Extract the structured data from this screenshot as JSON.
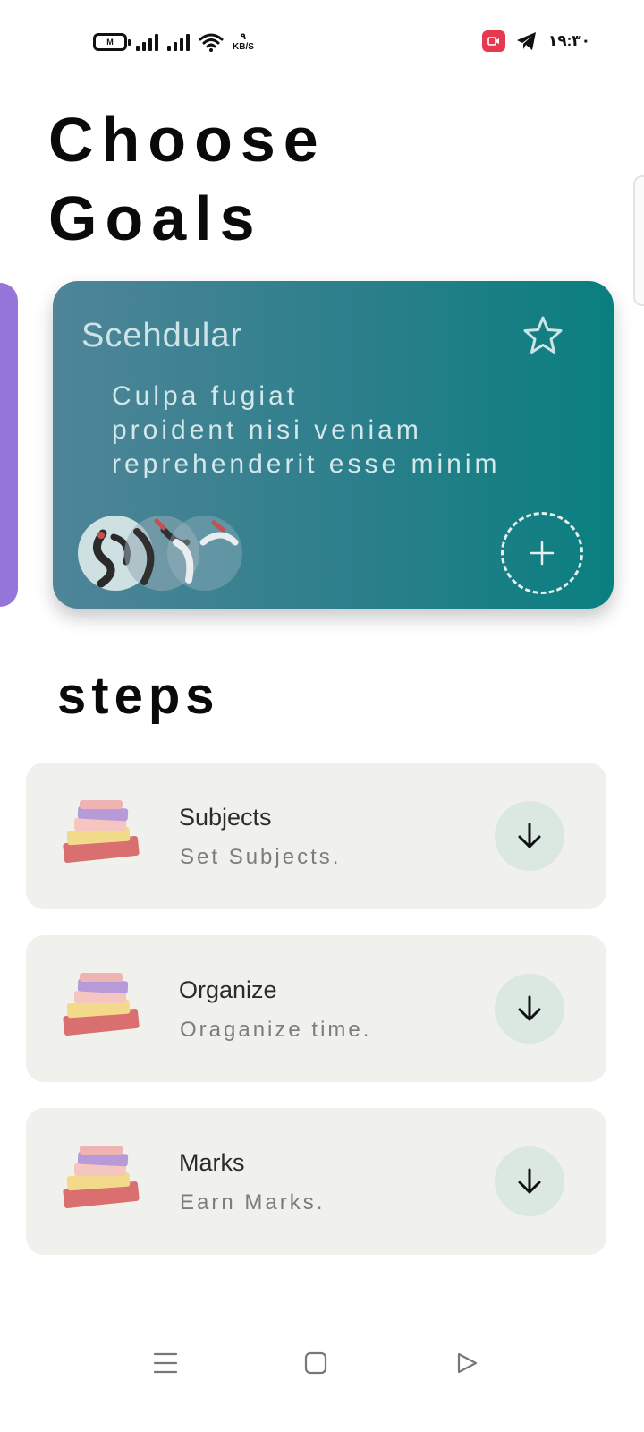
{
  "status_bar": {
    "time": "۱۹:۳۰",
    "network_speed_value": "۹",
    "network_speed_unit": "KB/S",
    "battery_label": "M",
    "icons": [
      "battery-icon",
      "signal-icon",
      "signal-icon",
      "wifi-icon",
      "screen-record-icon",
      "telegram-icon"
    ]
  },
  "page": {
    "title_line1": "Choose",
    "title_line2": "Goals"
  },
  "goal_card": {
    "title": "Scehdular",
    "body_line1": "Culpa fugiat",
    "body_line2": "proident nisi veniam",
    "body_line3": "reprehenderit esse minim",
    "favorite_icon": "star-outline-icon",
    "add_icon": "plus-icon",
    "colors": {
      "gradient_start": "#4f8598",
      "gradient_end": "#0a7f7f",
      "side_card": "#9575d9"
    }
  },
  "steps": {
    "title": "steps",
    "items": [
      {
        "name": "Subjects",
        "description": "Set Subjects.",
        "icon": "books-icon",
        "action_icon": "arrow-down-icon"
      },
      {
        "name": "Organize",
        "description": "Oraganize time.",
        "icon": "books-icon",
        "action_icon": "arrow-down-icon"
      },
      {
        "name": "Marks",
        "description": "Earn Marks.",
        "icon": "books-icon",
        "action_icon": "arrow-down-icon"
      }
    ]
  },
  "nav_bar": {
    "items": [
      "menu-icon",
      "home-square-icon",
      "back-triangle-icon"
    ]
  }
}
